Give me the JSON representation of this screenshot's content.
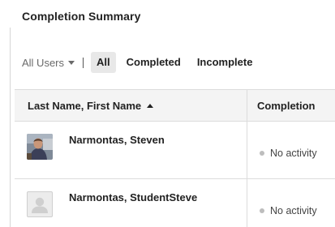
{
  "header": {
    "title": "Completion Summary"
  },
  "filters": {
    "users_dropdown_label": "All Users",
    "pills": [
      {
        "label": "All",
        "active": true
      },
      {
        "label": "Completed",
        "active": false
      },
      {
        "label": "Incomplete",
        "active": false
      }
    ]
  },
  "table": {
    "columns": [
      {
        "label": "Last Name, First Name",
        "sort": "ascending"
      },
      {
        "label": "Completion"
      }
    ],
    "rows": [
      {
        "name": "Narmontas, Steven",
        "avatar": "user-photo",
        "status": "No activity"
      },
      {
        "name": "Narmontas, StudentSteve",
        "avatar": "default-user-icon",
        "status": "No activity"
      }
    ]
  },
  "colors": {
    "status_dot": "#bdbdbd",
    "active_pill_bg": "#e8e8e8",
    "header_bg": "#f4f4f4"
  }
}
